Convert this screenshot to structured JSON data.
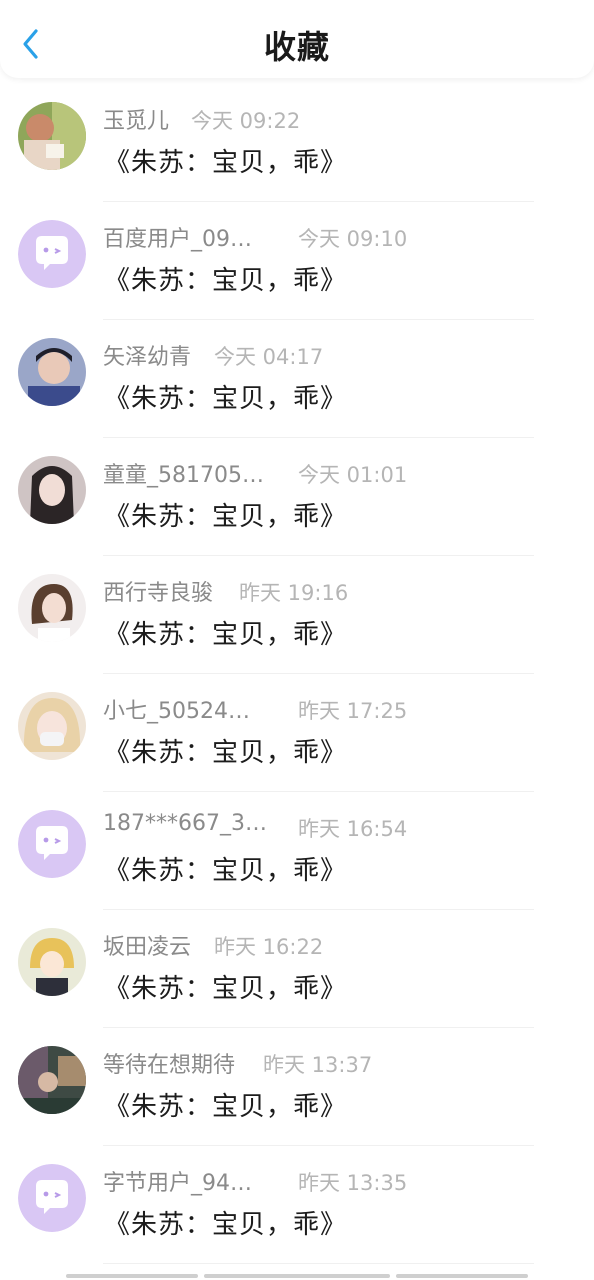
{
  "header": {
    "title": "收藏",
    "back_icon": "chevron-left-icon",
    "accent": "#2aa1e8"
  },
  "placeholder_avatar_color": "#d9c7f4",
  "items": [
    {
      "name": "玉觅儿",
      "time": "今天 09:22",
      "content": "《朱苏：宝贝，乖》",
      "avatar": "photo"
    },
    {
      "name": "百度用户_09…",
      "time": "今天 09:10",
      "content": "《朱苏：宝贝，乖》",
      "avatar": "default"
    },
    {
      "name": "矢泽幼青",
      "time": "今天 04:17",
      "content": "《朱苏：宝贝，乖》",
      "avatar": "photo"
    },
    {
      "name": "童童_581705…",
      "time": "今天 01:01",
      "content": "《朱苏：宝贝，乖》",
      "avatar": "photo"
    },
    {
      "name": "西行寺良骏",
      "time": "昨天 19:16",
      "content": "《朱苏：宝贝，乖》",
      "avatar": "photo"
    },
    {
      "name": "小七_50524…",
      "time": "昨天 17:25",
      "content": "《朱苏：宝贝，乖》",
      "avatar": "photo"
    },
    {
      "name": "187***667_3…",
      "time": "昨天 16:54",
      "content": "《朱苏：宝贝，乖》",
      "avatar": "default"
    },
    {
      "name": "坂田凌云",
      "time": "昨天 16:22",
      "content": "《朱苏：宝贝，乖》",
      "avatar": "photo"
    },
    {
      "name": "等待在想期待",
      "time": "昨天 13:37",
      "content": "《朱苏：宝贝，乖》",
      "avatar": "photo"
    },
    {
      "name": "字节用户_94…",
      "time": "昨天 13:35",
      "content": "《朱苏：宝贝，乖》",
      "avatar": "default"
    }
  ]
}
